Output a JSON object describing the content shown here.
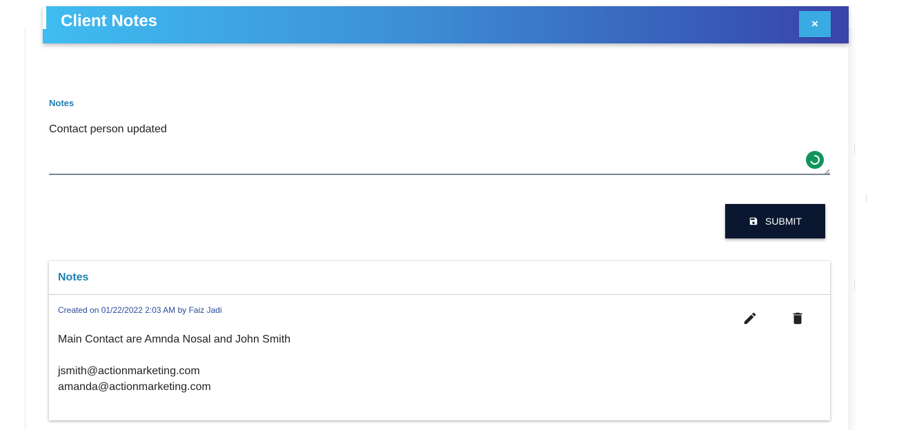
{
  "dialog": {
    "title": "Client Notes",
    "close_label": "×"
  },
  "form": {
    "notes_label": "Notes",
    "notes_value": "Contact person updated",
    "submit_label": "SUBMIT"
  },
  "notes_panel": {
    "title": "Notes",
    "items": [
      {
        "meta": "Created on 01/22/2022 2:03 AM by Faiz Jadi",
        "lines": [
          "Main Contact are Amnda Nosal and John Smith",
          "",
          "jsmith@actionmarketing.com",
          "amanda@actionmarketing.com"
        ],
        "actions": [
          "edit-icon",
          "delete-icon"
        ]
      }
    ]
  },
  "colors": {
    "header_gradient_start": "#3fbdf2",
    "header_gradient_end": "#3a43a8",
    "close_button": "#3aaae3",
    "submit_button": "#0b1730",
    "label_blue": "#1f7fb3",
    "meta_blue": "#2b4a9c",
    "spinner_green": "#12945c"
  }
}
